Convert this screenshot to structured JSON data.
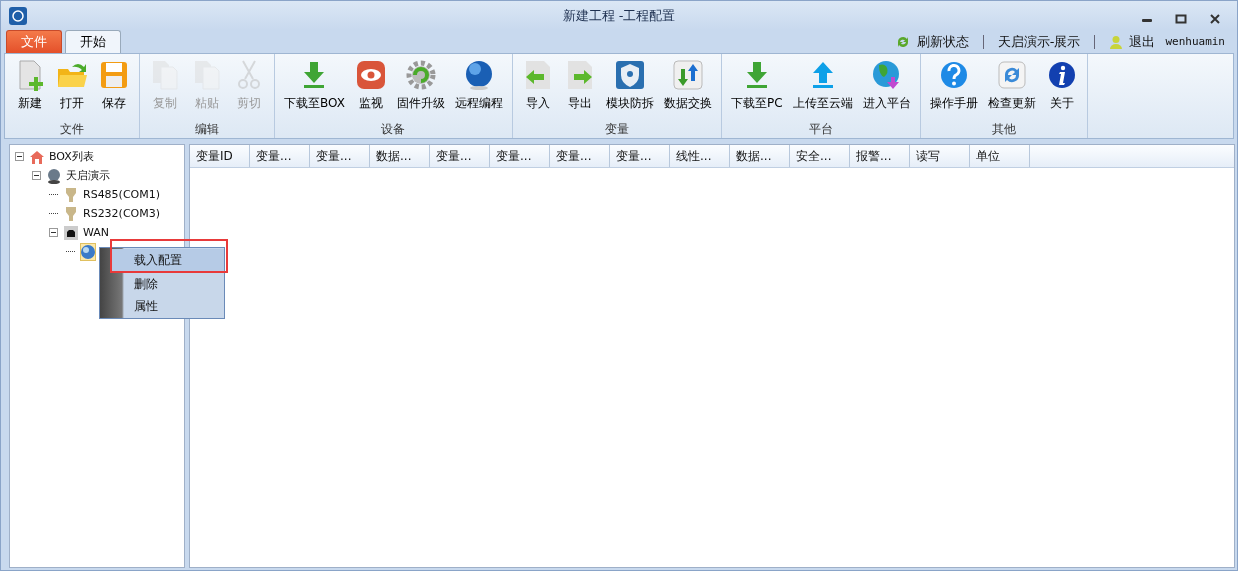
{
  "window": {
    "title": "新建工程 -工程配置"
  },
  "tabs": [
    {
      "label": "文件",
      "selected": false,
      "kind": "menu"
    },
    {
      "label": "开始",
      "selected": true,
      "kind": "tab"
    }
  ],
  "status": {
    "refresh": "刷新状态",
    "project": "天启演示-展示",
    "logout": "退出",
    "user": "wenhuamin"
  },
  "ribbon": [
    {
      "label": "文件",
      "buttons": [
        {
          "label": "新建",
          "disabled": false
        },
        {
          "label": "打开",
          "disabled": false
        },
        {
          "label": "保存",
          "disabled": false
        }
      ]
    },
    {
      "label": "编辑",
      "buttons": [
        {
          "label": "复制",
          "disabled": true
        },
        {
          "label": "粘贴",
          "disabled": true
        },
        {
          "label": "剪切",
          "disabled": true
        }
      ]
    },
    {
      "label": "设备",
      "buttons": [
        {
          "label": "下载至BOX",
          "disabled": false
        },
        {
          "label": "监视",
          "disabled": false
        },
        {
          "label": "固件升级",
          "disabled": false
        },
        {
          "label": "远程编程",
          "disabled": false
        }
      ]
    },
    {
      "label": "变量",
      "buttons": [
        {
          "label": "导入",
          "disabled": false
        },
        {
          "label": "导出",
          "disabled": false
        },
        {
          "label": "模块防拆",
          "disabled": false
        },
        {
          "label": "数据交换",
          "disabled": false
        }
      ]
    },
    {
      "label": "平台",
      "buttons": [
        {
          "label": "下载至PC",
          "disabled": false
        },
        {
          "label": "上传至云端",
          "disabled": false
        },
        {
          "label": "进入平台",
          "disabled": false
        }
      ]
    },
    {
      "label": "其他",
      "buttons": [
        {
          "label": "操作手册",
          "disabled": false
        },
        {
          "label": "检查更新",
          "disabled": false
        },
        {
          "label": "关于",
          "disabled": false
        }
      ]
    }
  ],
  "tree": [
    {
      "label": "BOX列表",
      "kind": "home",
      "expanded": true,
      "selected": false,
      "children": [
        {
          "label": "天启演示",
          "kind": "box",
          "expanded": true,
          "selected": false,
          "children": [
            {
              "label": "RS485(COM1)",
              "kind": "port",
              "selected": false
            },
            {
              "label": "RS232(COM3)",
              "kind": "port",
              "selected": false
            },
            {
              "label": "WAN",
              "kind": "network",
              "expanded": true,
              "selected": false,
              "children": [
                {
                  "kind": "globe",
                  "selected": true
                }
              ]
            }
          ]
        }
      ]
    }
  ],
  "context_menu": {
    "items": [
      {
        "label": "载入配置",
        "selected": true,
        "outlined": true
      },
      {
        "label": "删除",
        "selected": false,
        "outlined": false
      },
      {
        "label": "属性",
        "selected": false,
        "outlined": false
      }
    ]
  },
  "table": {
    "columns": [
      "变量ID",
      "变量...",
      "变量...",
      "数据...",
      "变量...",
      "变量...",
      "变量...",
      "变量...",
      "线性...",
      "数据...",
      "安全...",
      "报警...",
      "读写",
      "单位"
    ]
  }
}
